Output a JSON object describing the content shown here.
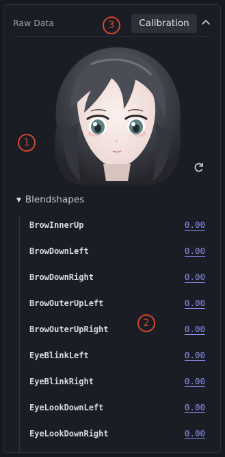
{
  "panel": {
    "title": "Raw Data",
    "calibration_label": "Calibration",
    "collapse_icon": "chevron-up-icon",
    "refresh_icon": "refresh-icon"
  },
  "annotations": [
    "1",
    "2",
    "3"
  ],
  "blendshapes": {
    "section_label": "Blendshapes",
    "items": [
      {
        "name": "BrowInnerUp",
        "value": "0.00"
      },
      {
        "name": "BrowDownLeft",
        "value": "0.00"
      },
      {
        "name": "BrowDownRight",
        "value": "0.00"
      },
      {
        "name": "BrowOuterUpLeft",
        "value": "0.00"
      },
      {
        "name": "BrowOuterUpRight",
        "value": "0.00"
      },
      {
        "name": "EyeBlinkLeft",
        "value": "0.00"
      },
      {
        "name": "EyeBlinkRight",
        "value": "0.00"
      },
      {
        "name": "EyeLookDownLeft",
        "value": "0.00"
      },
      {
        "name": "EyeLookDownRight",
        "value": "0.00"
      }
    ]
  },
  "colors": {
    "background": "#1a1d24",
    "accent_value": "#8d8ff0",
    "annotation": "#d3452c"
  }
}
